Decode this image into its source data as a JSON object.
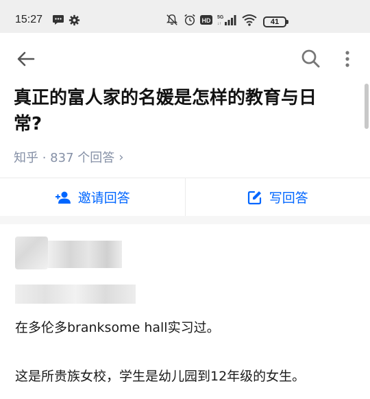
{
  "status_bar": {
    "time": "15:27",
    "battery": "41",
    "icons": [
      "message-icon",
      "settings-gear-icon",
      "mute-bell-icon",
      "alarm-icon",
      "hd-icon",
      "5g-signal-icon",
      "wifi-icon",
      "battery-icon"
    ]
  },
  "toolbar": {
    "icons": [
      "back-arrow-icon",
      "search-icon",
      "more-vertical-icon"
    ]
  },
  "question": {
    "title": "真正的富人家的名媛是怎样的教育与日常?",
    "meta": "知乎 · 837 个回答",
    "meta_chevron": "›"
  },
  "actions": {
    "invite_label": "邀请回答",
    "write_label": "写回答"
  },
  "colors": {
    "accent": "#0066ff",
    "muted_text": "#8590a6",
    "separator_band": "#f6f6f6"
  },
  "answer": {
    "paragraphs": [
      "在多伦多branksome hall实习过。",
      "这是所贵族女校，学生是幼儿园到12年级的女生。"
    ]
  }
}
